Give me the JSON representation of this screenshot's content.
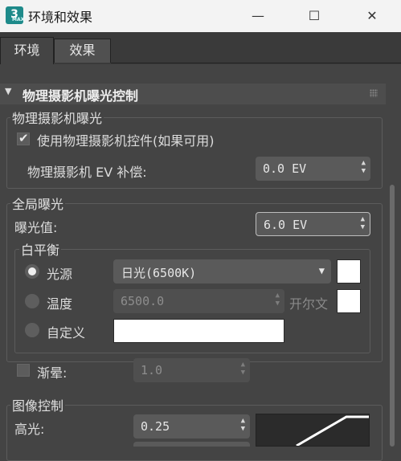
{
  "window": {
    "title": "环境和效果",
    "icon_text": "3",
    "icon_subtext": "MAX",
    "minimize_glyph": "—",
    "maximize_glyph": "☐",
    "close_glyph": "✕"
  },
  "tabs": [
    {
      "label": "环境",
      "active": true
    },
    {
      "label": "效果",
      "active": false
    }
  ],
  "rollout": {
    "title": "物理摄影机曝光控制",
    "expanded_glyph": "▼"
  },
  "camera_exposure": {
    "group_title": "物理摄影机曝光",
    "use_camera_controls": {
      "label": "使用物理摄影机控件(如果可用)",
      "checked": true,
      "check_glyph": "✔"
    },
    "ev_compensation": {
      "label": "物理摄影机 EV 补偿:",
      "value": "0.0 EV"
    }
  },
  "global_exposure": {
    "group_title": "全局曝光",
    "exposure_value": {
      "label": "曝光值:",
      "value": "6.0 EV"
    }
  },
  "white_balance": {
    "group_title": "白平衡",
    "light_source": {
      "label": "光源",
      "selected": true,
      "value": "日光(6500K)",
      "caret": "▼"
    },
    "temperature": {
      "label": "温度",
      "selected": false,
      "value": "6500.0",
      "unit": "开尔文"
    },
    "custom": {
      "label": "自定义",
      "selected": false
    }
  },
  "vignetting": {
    "label": "渐晕:",
    "checked": false,
    "value": "1.0"
  },
  "image_control": {
    "group_title": "图像控制",
    "highlights": {
      "label": "高光:",
      "value": "0.25"
    }
  },
  "spinner_arrows": "▲\n▼",
  "colors": {
    "background": "#444444",
    "titlebar": "#f3f3f3",
    "input": "#5a5a5a",
    "swatch": "#ffffff",
    "app_icon": "#1e8a8a"
  }
}
